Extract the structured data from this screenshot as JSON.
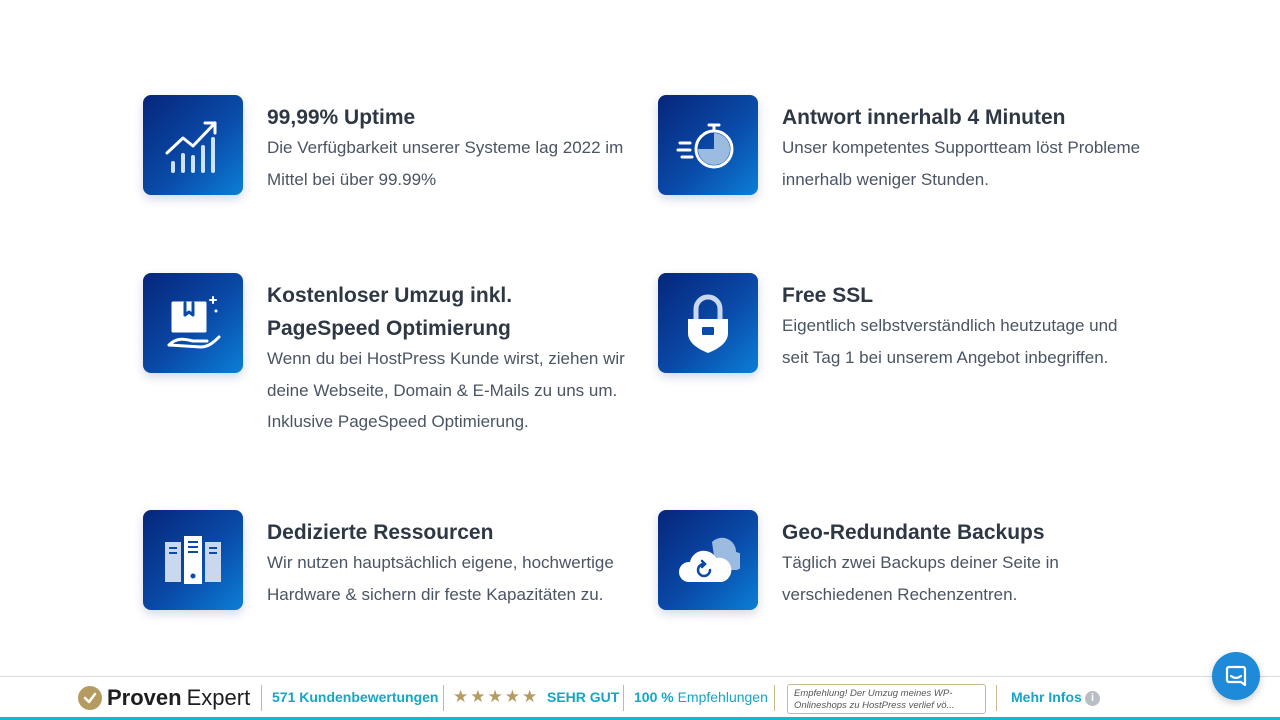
{
  "features": [
    {
      "title": "99,99% Uptime",
      "desc": "Die Verfügbarkeit unserer Systeme lag 2022 im Mittel bei über 99.99%",
      "icon": "chart-growth-icon"
    },
    {
      "title": "Antwort innerhalb 4 Minuten",
      "desc": "Unser kompetentes Supportteam löst Probleme innerhalb weniger Stunden.",
      "icon": "stopwatch-icon"
    },
    {
      "title": "Kostenloser Umzug inkl. PageSpeed Optimierung",
      "desc": "Wenn du bei HostPress Kunde wirst, ziehen wir deine Webseite, Domain & E-Mails zu uns um. Inklusive PageSpeed Optimierung.",
      "icon": "box-hand-icon"
    },
    {
      "title": "Free SSL",
      "desc": "Eigentlich selbstverständlich heutzutage und seit Tag 1 bei unserem Angebot inbegriffen.",
      "icon": "lock-shield-icon"
    },
    {
      "title": "Dedizierte Ressourcen",
      "desc": "Wir nutzen hauptsächlich eigene, hochwertige Hardware & sichern dir feste Kapazitäten zu.",
      "icon": "server-rack-icon"
    },
    {
      "title": "Geo-Redundante Backups",
      "desc": "Täglich zwei Backups deiner Seite in verschiedenen Rechenzentren.",
      "icon": "cloud-backup-icon"
    }
  ],
  "proven_expert": {
    "brand_bold": "Proven",
    "brand_light": "Expert",
    "reviews": "571 Kundenbewertungen",
    "stars": "★★★★★",
    "rating": "SEHR GUT",
    "recommend_pct": "100 %",
    "recommend_label": "Empfehlungen",
    "quote": "Empfehlung! Der Umzug meines WP-Onlineshops zu HostPress verlief vö...",
    "more_info": "Mehr Infos",
    "info_glyph": "i"
  },
  "colors": {
    "accent": "#14a6c3",
    "gold": "#b59b5f",
    "icon_gradient_start": "#06267a",
    "icon_gradient_end": "#0b7fd6",
    "chat": "#1f8ad8"
  }
}
